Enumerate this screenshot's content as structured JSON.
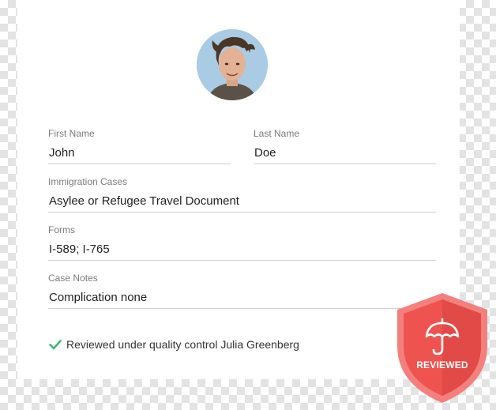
{
  "profile": {
    "first_name_label": "First Name",
    "first_name_value": "John",
    "last_name_label": "Last Name",
    "last_name_value": "Doe",
    "immigration_label": "Immigration Cases",
    "immigration_value": "Asylee or Refugee Travel Document",
    "forms_label": "Forms",
    "forms_value": "I-589; I-765",
    "notes_label": "Case Notes",
    "notes_value": "Complication none"
  },
  "review": {
    "text": "Reviewed under quality control Julia Greenberg",
    "icon": "check-icon",
    "icon_color": "#3cb878"
  },
  "badge": {
    "label": "REVIEWED",
    "icon": "umbrella-icon",
    "color": "#f05252"
  }
}
